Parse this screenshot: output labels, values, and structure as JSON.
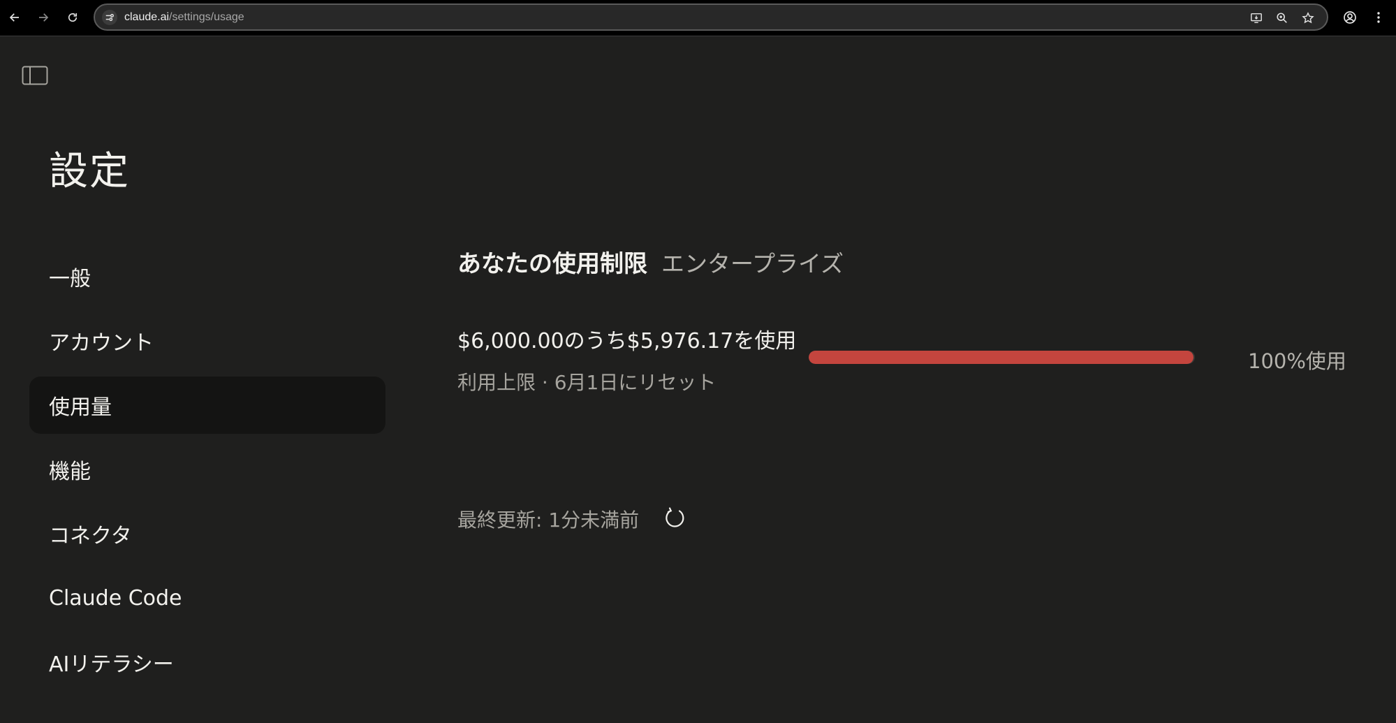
{
  "browser": {
    "url_host": "claude.ai",
    "url_path": "/settings/usage",
    "icons": [
      "back-icon",
      "forward-icon",
      "reload-icon",
      "site-info-icon",
      "install-app-icon",
      "zoom-icon",
      "bookmark-star-icon",
      "profile-icon",
      "menu-icon"
    ]
  },
  "page": {
    "sidebar_toggle_icon": "sidebar-toggle-icon",
    "title": "設定"
  },
  "settings_nav": {
    "items": [
      {
        "label": "一般",
        "active": false
      },
      {
        "label": "アカウント",
        "active": false
      },
      {
        "label": "使用量",
        "active": true
      },
      {
        "label": "機能",
        "active": false
      },
      {
        "label": "コネクタ",
        "active": false
      },
      {
        "label": "Claude Code",
        "active": false
      },
      {
        "label": "AIリテラシー",
        "active": false
      }
    ]
  },
  "usage": {
    "title": "あなたの使用制限",
    "plan": "エンタープライズ",
    "amount_text": "$6,000.00のうち$5,976.17を使用",
    "reset_text": "利用上限 · 6月1日にリセット",
    "percent_text": "100%使用",
    "progress_fraction": 0.996,
    "last_updated": "最終更新: 1分未満前",
    "refresh_icon": "refresh-icon"
  },
  "colors": {
    "background": "#1f1f1e",
    "active_nav": "#141413",
    "progress_fill": "#c4453e",
    "progress_track": "#3a3936"
  }
}
